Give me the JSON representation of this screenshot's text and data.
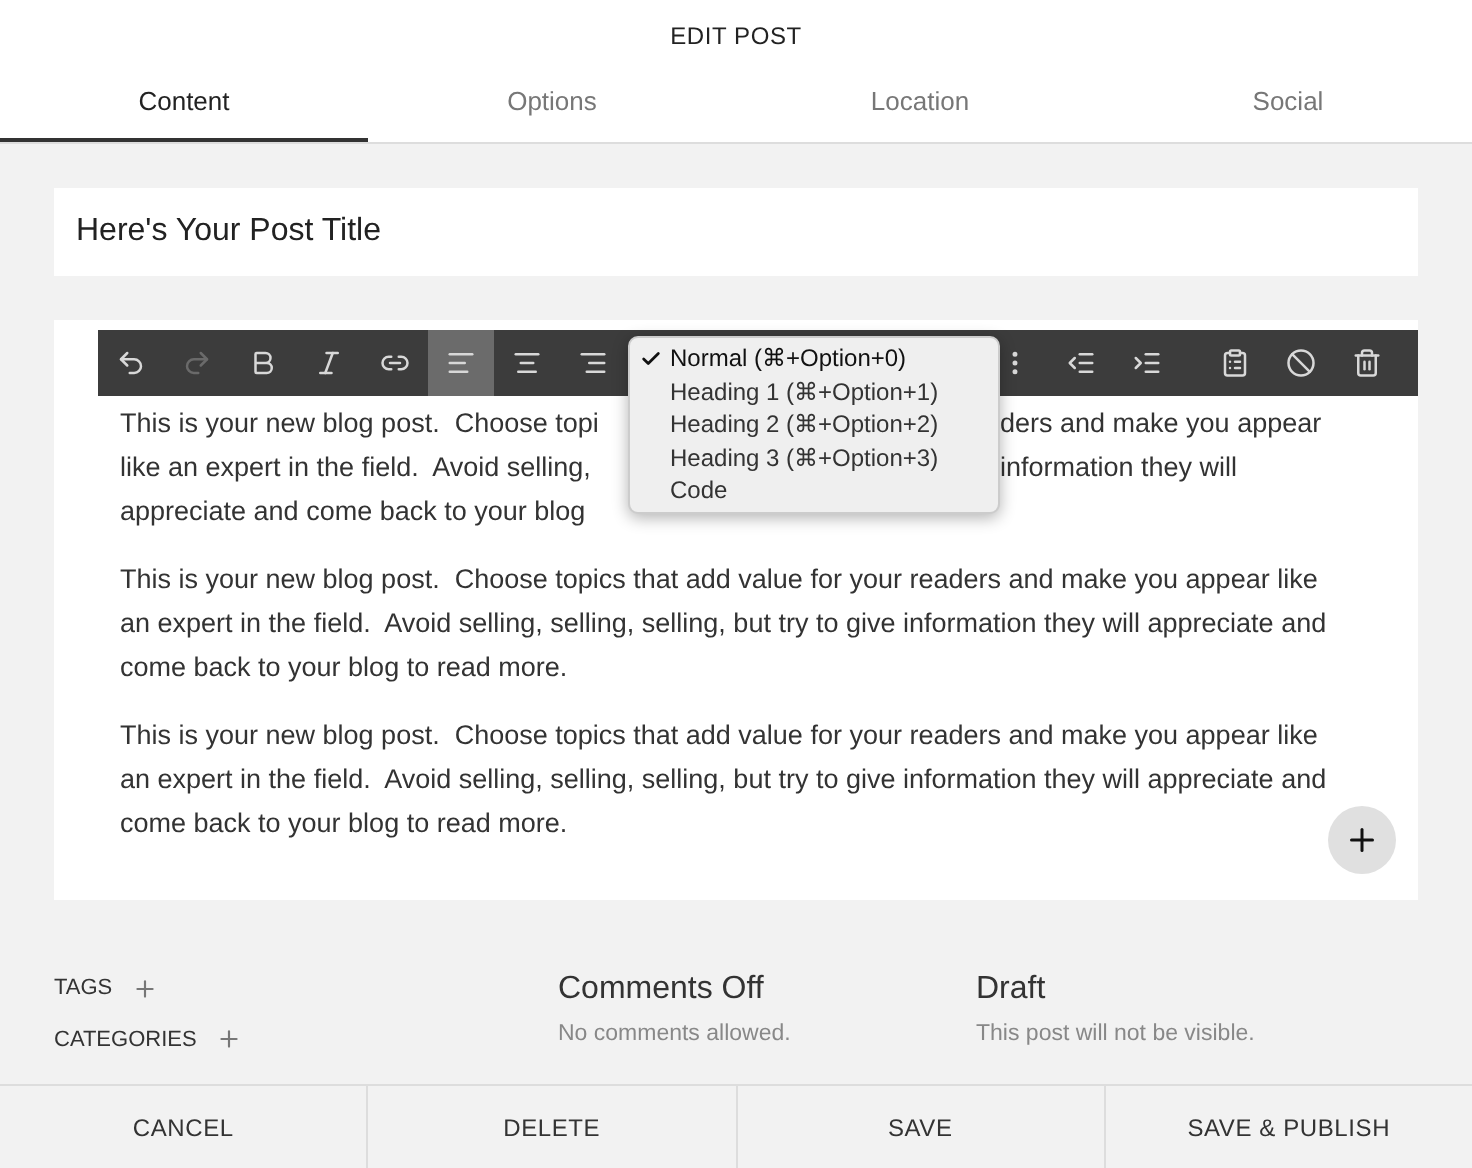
{
  "header": {
    "title": "EDIT POST"
  },
  "tabs": [
    {
      "label": "Content",
      "selected": true
    },
    {
      "label": "Options",
      "selected": false
    },
    {
      "label": "Location",
      "selected": false
    },
    {
      "label": "Social",
      "selected": false
    }
  ],
  "post_title": {
    "value": "Here's Your Post Title"
  },
  "toolbar": {
    "left": [
      {
        "kind": "undo",
        "disabled": false,
        "selected": false
      },
      {
        "kind": "redo",
        "disabled": true,
        "selected": false
      },
      {
        "kind": "bold",
        "disabled": false,
        "selected": false
      },
      {
        "kind": "italic",
        "disabled": false,
        "selected": false
      },
      {
        "kind": "link",
        "disabled": false,
        "selected": false
      },
      {
        "kind": "align-left",
        "disabled": false,
        "selected": true
      },
      {
        "kind": "align-center",
        "disabled": false,
        "selected": false
      },
      {
        "kind": "align-right",
        "disabled": false,
        "selected": false
      }
    ],
    "right": [
      {
        "kind": "more",
        "disabled": false,
        "selected": false
      },
      {
        "kind": "outdent",
        "disabled": false,
        "selected": false
      },
      {
        "kind": "indent",
        "disabled": false,
        "selected": false
      },
      {
        "kind": "clipboard",
        "disabled": false,
        "selected": false
      },
      {
        "kind": "clear",
        "disabled": false,
        "selected": false
      },
      {
        "kind": "delete",
        "disabled": false,
        "selected": false
      }
    ]
  },
  "format_menu": [
    {
      "label": "Normal (⌘+Option+0)",
      "selected": true
    },
    {
      "label": "Heading 1 (⌘+Option+1)",
      "selected": false
    },
    {
      "label": "Heading 2 (⌘+Option+2)",
      "selected": false
    },
    {
      "label": "Heading 3 (⌘+Option+3)",
      "selected": false
    },
    {
      "label": "Code",
      "selected": false
    }
  ],
  "first_paragraph_lines": [
    {
      "left": "This is your new blog post.  Choose topi",
      "right": "ders and make you appear"
    },
    {
      "left": "like an expert in the field.  Avoid selling,",
      "right": "information they will"
    },
    {
      "left": "appreciate and come back to your blog"
    }
  ],
  "paragraphs": [
    "This is your new blog post.  Choose topics that add value for your readers and make you appear like an expert in the field.  Avoid selling, selling, selling, but try to give information they will appreciate and come back to your blog to read more.",
    "This is your new blog post.  Choose topics that add value for your readers and make you appear like an expert in the field.  Avoid selling, selling, selling, but try to give information they will appreciate and come back to your blog to read more."
  ],
  "meta": {
    "tags_label": "TAGS",
    "categories_label": "CATEGORIES",
    "comments": {
      "title": "Comments Off",
      "note": "No comments allowed."
    },
    "status": {
      "title": "Draft",
      "note": "This post will not be visible."
    }
  },
  "actions": [
    "CANCEL",
    "DELETE",
    "SAVE",
    "SAVE & PUBLISH"
  ]
}
